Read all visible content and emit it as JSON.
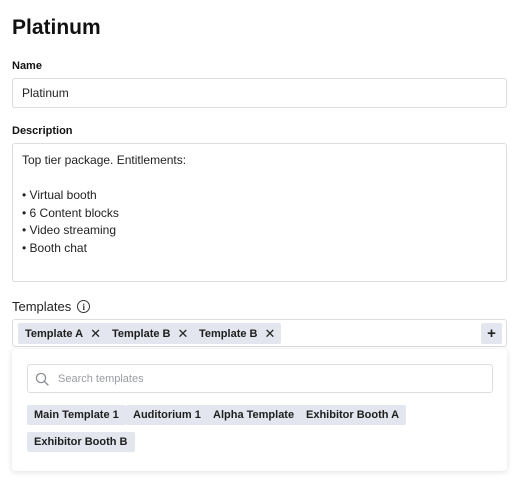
{
  "page": {
    "title": "Platinum"
  },
  "name_field": {
    "label": "Name",
    "value": "Platinum"
  },
  "description_field": {
    "label": "Description",
    "lines": [
      "Top tier package. Entitlements:",
      "",
      "• Virtual booth",
      "• 6 Content blocks",
      "• Video streaming",
      "• Booth chat"
    ]
  },
  "templates": {
    "label": "Templates",
    "info_icon": "info-circle-icon",
    "selected": [
      "Template A",
      "Template B",
      "Template B"
    ],
    "remove_glyph": "✕",
    "add_glyph": "+",
    "dropdown": {
      "search_placeholder": "Search templates",
      "options": [
        "Main Template 1",
        "Auditorium 1",
        "Alpha Template",
        "Exhibitor Booth A",
        "Exhibitor Booth B"
      ]
    }
  },
  "colors": {
    "chip_bg": "#e3e6ee",
    "border": "#dcdde0",
    "text": "#1a1a1a"
  }
}
